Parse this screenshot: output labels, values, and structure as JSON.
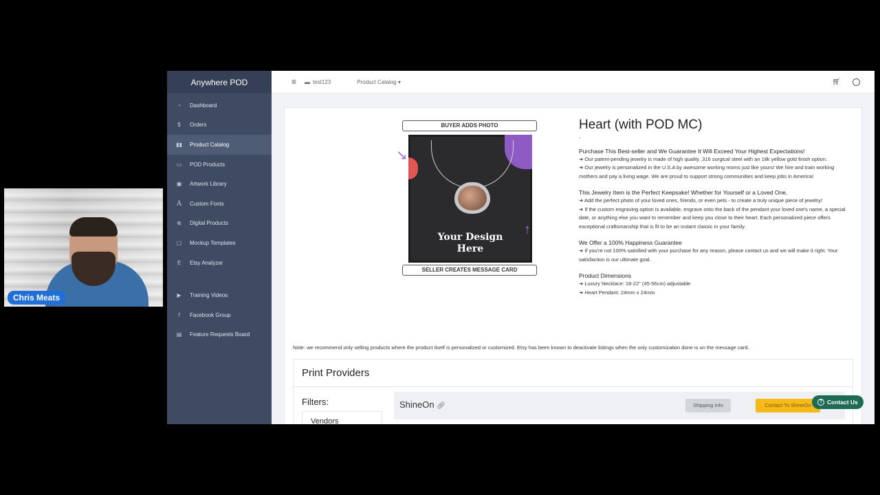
{
  "webcam": {
    "name": "Chris Meats"
  },
  "sidebar": {
    "brand": "Anywhere POD",
    "items": [
      {
        "label": "Dashboard",
        "icon": "dashboard-icon"
      },
      {
        "label": "Orders",
        "icon": "dollar-icon"
      },
      {
        "label": "Product Catalog",
        "icon": "book-icon",
        "active": true
      },
      {
        "label": "POD Products",
        "icon": "truck-icon"
      },
      {
        "label": "Artwork Library",
        "icon": "image-icon"
      },
      {
        "label": "Custom Fonts",
        "icon": "font-icon"
      },
      {
        "label": "Digital Products",
        "icon": "images-icon"
      },
      {
        "label": "Mockup Templates",
        "icon": "frame-icon"
      },
      {
        "label": "Etsy Analyzer",
        "icon": "etsy-icon"
      }
    ],
    "items2": [
      {
        "label": "Training Videos",
        "icon": "youtube-icon"
      },
      {
        "label": "Facebook Group",
        "icon": "facebook-icon"
      },
      {
        "label": "Feature Requests Board",
        "icon": "clipboard-icon"
      }
    ]
  },
  "topbar": {
    "store": "test123",
    "catalog": "Product Catalog ▾"
  },
  "product": {
    "image": {
      "top_label": "BUYER ADDS PHOTO",
      "design_line1": "Your Design",
      "design_line2": "Here",
      "bottom_label": "SELLER CREATES MESSAGE CARD"
    },
    "title": "Heart (with POD MC)",
    "dash": "-",
    "sections": [
      {
        "title": "Purchase This Best-seller and We Guarantee It Will Exceed Your Highest Expectations!",
        "lines": [
          "➜ Our patent-pending jewelry is made of high quality .316 surgical steel with an 18k yellow gold finish option.",
          "➜ Our jewelry is personalized in the U.S.A by awesome working moms just like yours! We hire and train working mothers and pay a living wage. We are proud to support strong communities and keep jobs in America!"
        ]
      },
      {
        "title": "This Jewelry Item is the Perfect Keepsake! Whether for Yourself or a Loved One.",
        "lines": [
          "➜ Add the perfect photo of your loved ones, friends, or even pets - to create a truly unique piece of jewelry!",
          "➜ If the custom engraving option is available, engrave onto the back of the pendant your loved one's name, a special date, or anything else you want to remember and keep you close to their heart. Each personalized piece offers exceptional craftsmanship that is fit to be an instant classic in your family."
        ]
      },
      {
        "title": "We Offer a 100% Happiness Guarantee",
        "lines": [
          "➜ If you're not 100% satisfied with your purchase for any reason, please contact us and we will make it right. Your satisfaction is our ultimate goal."
        ]
      },
      {
        "title": "Product Dimensions",
        "lines": [
          "➜ Luxury Necklace: 18-22\" (45-56cm) adjustable",
          "➜ Heart Pendant: 24mm x 24mm"
        ]
      }
    ],
    "note": "Note: we recommend only selling products where the product itself is personalized or customized. Etsy has been known to deactivate listings when the only customization done is on the message card."
  },
  "providers": {
    "title": "Print Providers",
    "filters_label": "Filters:",
    "vendors_label": "Vendors",
    "vendor": {
      "name": "ShineOn",
      "shipping": "Shipping Info",
      "contact": "Contact To ShineOn"
    }
  },
  "contact_us": "Contact Us"
}
